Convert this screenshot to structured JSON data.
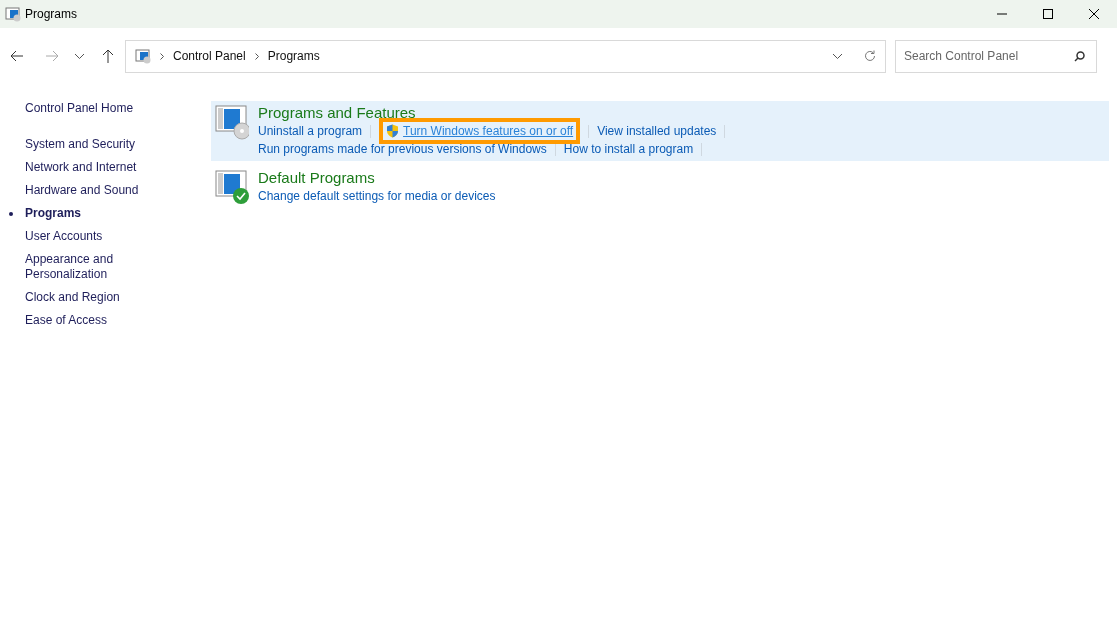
{
  "window": {
    "title": "Programs"
  },
  "address_bar": {
    "breadcrumb": [
      "Control Panel",
      "Programs"
    ]
  },
  "search": {
    "placeholder": "Search Control Panel"
  },
  "sidebar": {
    "home": "Control Panel Home",
    "items": [
      {
        "label": "System and Security",
        "selected": false
      },
      {
        "label": "Network and Internet",
        "selected": false
      },
      {
        "label": "Hardware and Sound",
        "selected": false
      },
      {
        "label": "Programs",
        "selected": true
      },
      {
        "label": "User Accounts",
        "selected": false
      },
      {
        "label": "Appearance and Personalization",
        "selected": false
      },
      {
        "label": "Clock and Region",
        "selected": false
      },
      {
        "label": "Ease of Access",
        "selected": false
      }
    ]
  },
  "categories": [
    {
      "title": "Programs and Features",
      "kind": "disc",
      "hovered": true,
      "link_rows": [
        [
          {
            "label": "Uninstall a program",
            "shield": false,
            "highlighted": false
          },
          {
            "label": "Turn Windows features on or off",
            "shield": true,
            "highlighted": true
          },
          {
            "label": "View installed updates",
            "shield": false,
            "highlighted": false
          }
        ],
        [
          {
            "label": "Run programs made for previous versions of Windows",
            "shield": false,
            "highlighted": false
          },
          {
            "label": "How to install a program",
            "shield": false,
            "highlighted": false
          }
        ]
      ]
    },
    {
      "title": "Default Programs",
      "kind": "check",
      "hovered": false,
      "link_rows": [
        [
          {
            "label": "Change default settings for media or devices",
            "shield": false,
            "highlighted": false
          }
        ]
      ]
    }
  ]
}
